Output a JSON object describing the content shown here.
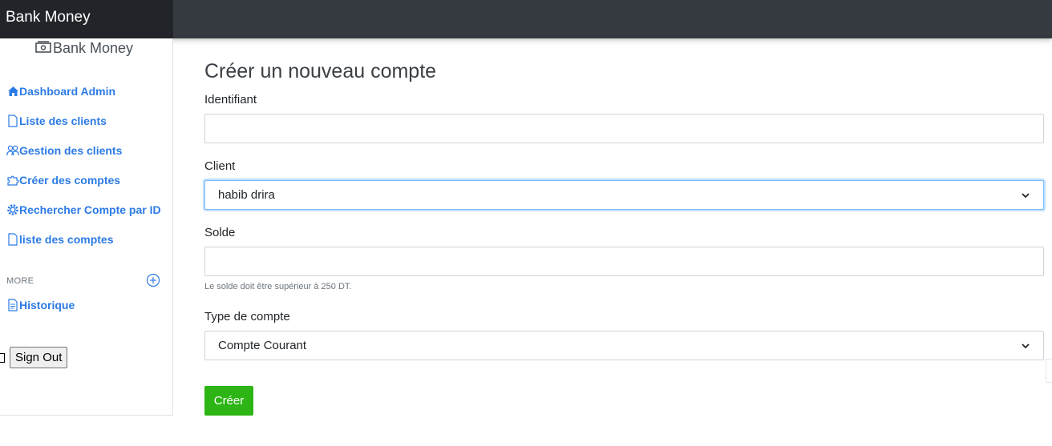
{
  "app": {
    "title": "Bank Money"
  },
  "sidebar": {
    "brand": "Bank Money",
    "items": [
      {
        "label": "Dashboard Admin",
        "icon": "house-icon"
      },
      {
        "label": "Liste des clients",
        "icon": "file-icon"
      },
      {
        "label": "Gestion des clients",
        "icon": "people-icon"
      },
      {
        "label": "Créer des comptes",
        "icon": "puzzle-icon"
      },
      {
        "label": "Rechercher Compte par ID",
        "icon": "gear-icon"
      },
      {
        "label": "liste des comptes",
        "icon": "file-icon"
      }
    ],
    "more_heading": "MORE",
    "more_items": [
      {
        "label": "Historique",
        "icon": "file-text-icon"
      }
    ],
    "signout_label": "Sign Out"
  },
  "form": {
    "title": "Créer un nouveau compte",
    "identifiant_label": "Identifiant",
    "identifiant_value": "",
    "client_label": "Client",
    "client_selected": "habib drira",
    "solde_label": "Solde",
    "solde_value": "",
    "solde_help": "Le solde doit être supérieur à 250 DT.",
    "type_label": "Type de compte",
    "type_selected": "Compte Courant",
    "submit_label": "Créer"
  },
  "colors": {
    "topbar": "#343a40",
    "link": "#2c7be5",
    "submit": "#2cb515",
    "focus": "#80bdff"
  }
}
